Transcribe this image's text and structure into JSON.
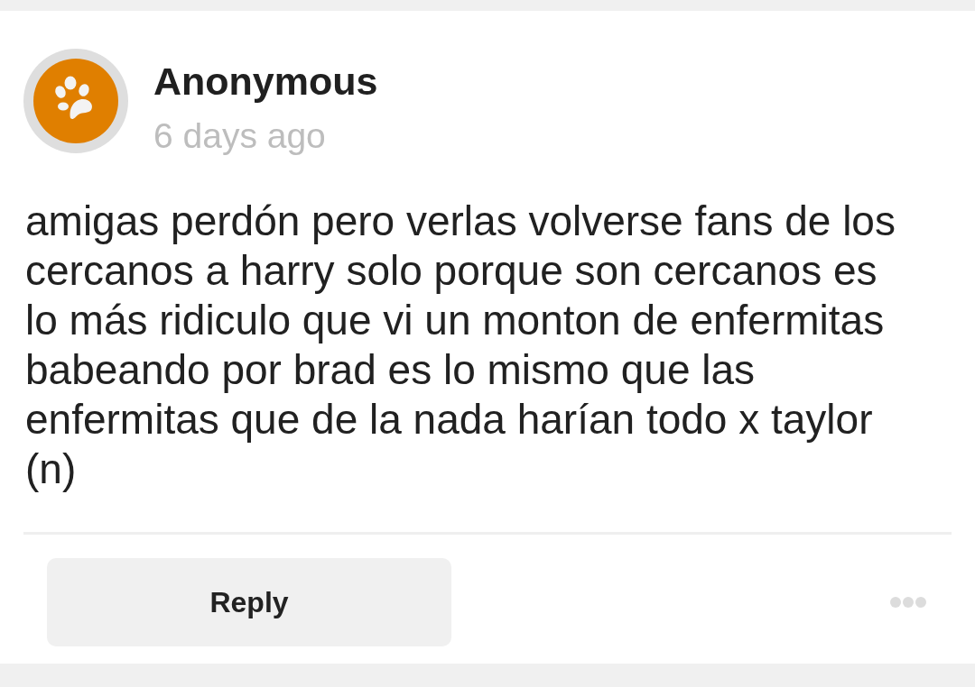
{
  "comment": {
    "author": "Anonymous",
    "time": "6 days ago",
    "body": "amigas perdón pero verlas volverse fans de los cercanos a harry solo porque son cercanos es lo más ridiculo que vi un monton de enfermitas babeando por brad es lo mismo que las enfermitas que de la nada harían todo x taylor (n)",
    "reply_button": "Reply"
  }
}
